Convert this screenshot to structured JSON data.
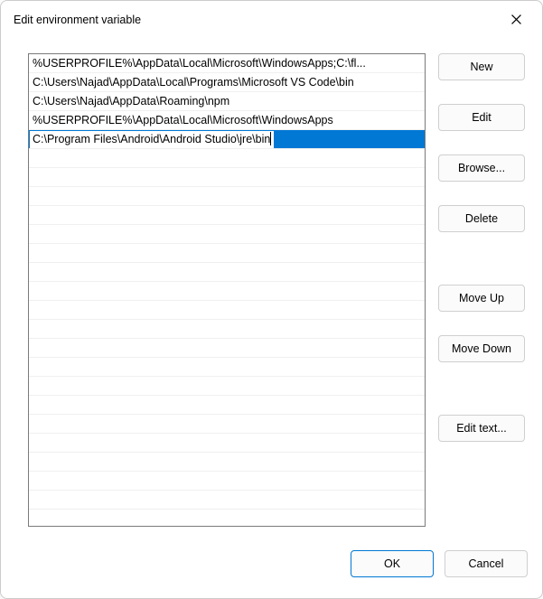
{
  "window": {
    "title": "Edit environment variable"
  },
  "list": {
    "items": [
      "%USERPROFILE%\\AppData\\Local\\Microsoft\\WindowsApps;C:\\fl...",
      "C:\\Users\\Najad\\AppData\\Local\\Programs\\Microsoft VS Code\\bin",
      "C:\\Users\\Najad\\AppData\\Roaming\\npm",
      "%USERPROFILE%\\AppData\\Local\\Microsoft\\WindowsApps"
    ],
    "editing_value": "C:\\Program Files\\Android\\Android Studio\\jre\\bin"
  },
  "buttons": {
    "new": "New",
    "edit": "Edit",
    "browse": "Browse...",
    "delete": "Delete",
    "move_up": "Move Up",
    "move_down": "Move Down",
    "edit_text": "Edit text...",
    "ok": "OK",
    "cancel": "Cancel"
  }
}
